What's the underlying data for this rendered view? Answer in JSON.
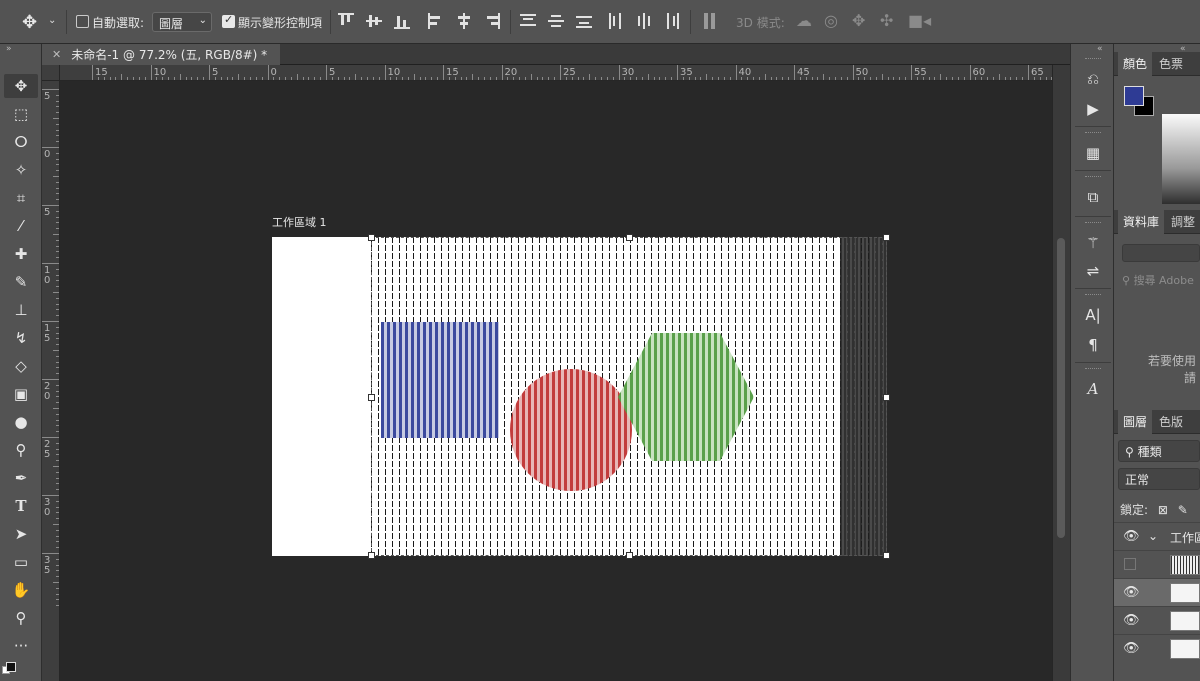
{
  "options_bar": {
    "auto_select_label": "自動選取:",
    "auto_select_checked": false,
    "auto_select_target": "圖層",
    "show_transform_label": "顯示變形控制項",
    "show_transform_checked": true,
    "mode_3d_label": "3D 模式:"
  },
  "document_tab": {
    "title": "未命名-1 @ 77.2% (五, RGB/8#) *"
  },
  "ruler_h_labels": [
    "15",
    "10",
    "5",
    "0",
    "5",
    "10",
    "15",
    "20",
    "25",
    "30",
    "35",
    "40",
    "45",
    "50",
    "55",
    "60",
    "65"
  ],
  "ruler_v_labels": [
    "5",
    "0",
    "5",
    "1\n0",
    "1\n5",
    "2\n0",
    "2\n5",
    "3\n0",
    "3\n5"
  ],
  "artboard": {
    "label": "工作區域 1"
  },
  "colors": {
    "foreground": "#2e3b94",
    "background": "#000000",
    "shape_blue": "#3b4a9e",
    "shape_red": "#c23c3c",
    "shape_green": "#5aa04a"
  },
  "panels": {
    "color_tabs": [
      "顏色",
      "色票"
    ],
    "library_tabs": [
      "資料庫",
      "調整"
    ],
    "library_search_placeholder": "搜尋 Adobe",
    "library_hint_line1": "若要使用",
    "library_hint_line2": "請",
    "layers_tabs": [
      "圖層",
      "色版"
    ],
    "layer_filter": "種類",
    "blend_mode": "正常",
    "lock_label": "鎖定:",
    "group_name": "工作區"
  }
}
